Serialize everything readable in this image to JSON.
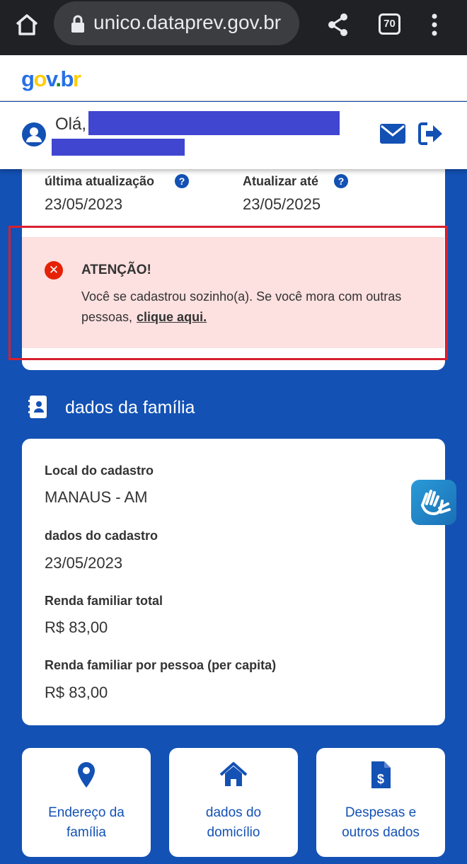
{
  "browser": {
    "url": "unico.dataprev.gov.br",
    "tab_count": "70"
  },
  "header": {
    "logo_text": "gov.br",
    "greeting": "Olá,"
  },
  "summary": {
    "last_update_label": "última atualização",
    "last_update_value": "23/05/2023",
    "update_until_label": "Atualizar até",
    "update_until_value": "23/05/2025"
  },
  "alert": {
    "title": "ATENÇÃO!",
    "message": "Você se cadastrou sozinho(a). Se você mora com outras pessoas,",
    "link": "clique aqui."
  },
  "family_section": {
    "title": "dados da família",
    "fields": [
      {
        "label": "Local do cadastro",
        "value": "MANAUS - AM"
      },
      {
        "label": "dados do cadastro",
        "value": "23/05/2023"
      },
      {
        "label": "Renda familiar total",
        "value": "R$ 83,00"
      },
      {
        "label": "Renda familiar por pessoa (per capita)",
        "value": "R$ 83,00"
      }
    ]
  },
  "tiles": [
    {
      "line1": "Endereço da",
      "line2": "família",
      "icon": "map-pin-icon"
    },
    {
      "line1": "dados do",
      "line2": "domicílio",
      "icon": "house-icon"
    },
    {
      "line1": "Despesas e",
      "line2": "outros dados",
      "icon": "invoice-icon"
    }
  ],
  "colors": {
    "primary": "#1351b4",
    "alert_bg": "#fde0e0",
    "alert_icon": "#e52207",
    "highlight_frame": "#d8202f"
  }
}
